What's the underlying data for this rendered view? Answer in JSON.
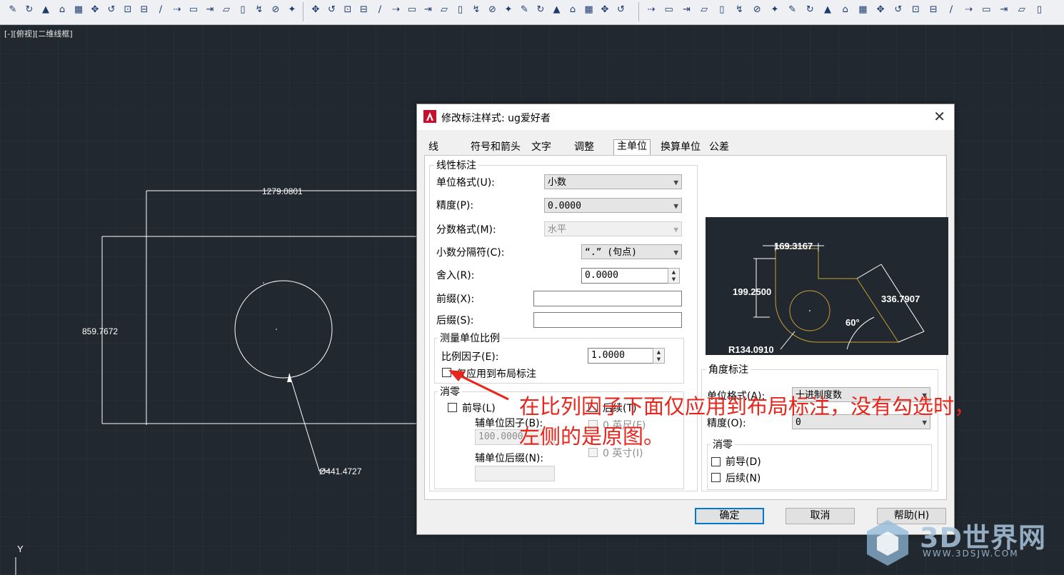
{
  "toolbar": {
    "groups": [
      {
        "icons": [
          "line-icon",
          "polyline-icon",
          "circle-icon",
          "arc-icon",
          "rectangle-icon",
          "hatch-icon",
          "move-icon",
          "rotate-icon",
          "scale-icon",
          "stretch-icon",
          "trim-icon",
          "extend-icon",
          "fillet-icon",
          "chamfer-icon",
          "array-icon",
          "mirror-icon",
          "offset-icon",
          "explode-icon"
        ]
      },
      {
        "icons": [
          "line-icon",
          "construction-line-icon",
          "polyline-icon",
          "polygon-icon",
          "rectangle-icon",
          "arc-icon",
          "circle-icon",
          "revcloud-icon",
          "spline-icon",
          "ellipse-icon",
          "ellipse-arc-icon",
          "insert-block-icon",
          "make-block-icon",
          "point-icon",
          "hatch-icon",
          "gradient-icon",
          "region-icon",
          "table-icon",
          "mtext-icon",
          "add-selected-icon"
        ]
      },
      {
        "icons": [
          "new-icon",
          "open-icon",
          "save-icon",
          "plot-icon",
          "preview-icon",
          "publish-icon",
          "3dprint-icon",
          "cut-icon",
          "copy-icon",
          "paste-icon",
          "match-properties-icon",
          "block-editor-icon",
          "undo-icon",
          "redo-icon",
          "pan-icon",
          "zoom-realtime-icon",
          "zoom-window-icon",
          "zoom-previous-icon",
          "properties-icon",
          "design-center-icon",
          "tool-palettes-icon",
          "sheet-set-icon",
          "markup-icon"
        ]
      }
    ]
  },
  "viewport_label": "[-][俯视][二维线框]",
  "drawing": {
    "dim_horizontal": "1279.0801",
    "dim_vertical": "859.7672",
    "dim_diameter": "Ø441.4727",
    "ucs_y": "Y"
  },
  "dialog": {
    "title": "修改标注样式: ug爱好者",
    "close": "✕",
    "tabs": [
      "线",
      "符号和箭头",
      "文字",
      "调整",
      "主单位",
      "换算单位",
      "公差"
    ],
    "active_tab": "主单位",
    "linear": {
      "legend": "线性标注",
      "unit_format_label": "单位格式(U):",
      "unit_format_value": "小数",
      "precision_label": "精度(P):",
      "precision_value": "0.0000",
      "fraction_label": "分数格式(M):",
      "fraction_value": "水平",
      "decimal_sep_label": "小数分隔符(C):",
      "decimal_sep_value": "“.” (句点)",
      "roundoff_label": "舍入(R):",
      "roundoff_value": "0.0000",
      "prefix_label": "前缀(X):",
      "prefix_value": "",
      "suffix_label": "后缀(S):",
      "suffix_value": ""
    },
    "scale": {
      "legend": "测量单位比例",
      "factor_label": "比例因子(E):",
      "factor_value": "1.0000",
      "layout_only_label": "仅应用到布局标注"
    },
    "zero": {
      "legend": "消零",
      "leading_label": "前导(L)",
      "trailing_label": "后续(T)",
      "sub_factor_label": "辅单位因子(B):",
      "sub_factor_value": "100.0000",
      "sub_suffix_label": "辅单位后缀(N):",
      "sub_suffix_value": "",
      "feet_label": "0 英尺(F)",
      "inch_label": "0 英寸(I)"
    },
    "preview": {
      "dim_top": "169.3167",
      "dim_left": "199.2500",
      "dim_slant": "336.7907",
      "angle": "60°",
      "radius": "R134.0910"
    },
    "angular": {
      "legend": "角度标注",
      "unit_format_label": "单位格式(A):",
      "unit_format_value": "十进制度数",
      "precision_label": "精度(O):",
      "precision_value": "0",
      "zero_legend": "消零",
      "leading_label": "前导(D)",
      "trailing_label": "后续(N)"
    },
    "buttons": {
      "ok": "确定",
      "cancel": "取消",
      "help": "帮助(H)"
    }
  },
  "annotation": {
    "line1": "在比列因子下面仅应用到布局标注，没有勾选时，",
    "line2": "左侧的是原图。"
  },
  "watermark": {
    "name": "3D世界网",
    "url": "WWW.3DSJW.COM"
  },
  "colors": {
    "canvas": "#212830",
    "dim_yellow": "#c8a032",
    "annotation": "#e8261c",
    "accent": "#0078d7"
  }
}
